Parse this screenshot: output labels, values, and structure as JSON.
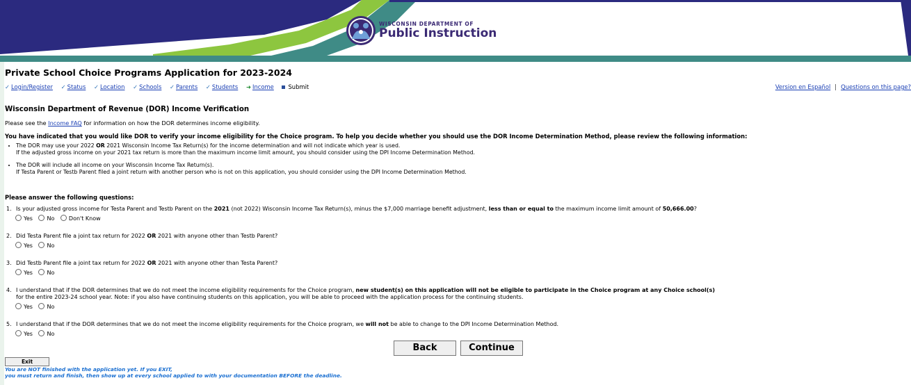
{
  "header": {
    "org_line1": "WISCONSIN DEPARTMENT OF",
    "org_line2": "Public Instruction"
  },
  "app": {
    "title": "Private School Choice Programs Application for 2023-2024"
  },
  "steps": [
    {
      "label": "Login/Register",
      "state": "done"
    },
    {
      "label": "Status",
      "state": "done"
    },
    {
      "label": "Location",
      "state": "done"
    },
    {
      "label": "Schools",
      "state": "done"
    },
    {
      "label": "Parents",
      "state": "done"
    },
    {
      "label": "Students",
      "state": "done"
    },
    {
      "label": "Income",
      "state": "current"
    },
    {
      "label": "Submit",
      "state": "pending"
    }
  ],
  "toplinks": {
    "spanish": "Version en Español",
    "separator": "|",
    "questions": "Questions on this page?"
  },
  "section": {
    "title": "Wisconsin Department of Revenue (DOR) Income Verification",
    "see_prefix": "Please see the ",
    "faq_link": "Income FAQ",
    "see_suffix": " for information on how the DOR determines income eligibility.",
    "intro": "You have indicated that you would like DOR to verify your income eligibility for the Choice program. To help you decide whether you should use the DOR Income Determination Method, please review the following information:"
  },
  "info": [
    {
      "l1_a": "The DOR may use your 2022 ",
      "l1_b": "OR",
      "l1_c": " 2021 Wisconsin Income Tax Return(s) for the income determination and will not indicate which year is used.",
      "l2": "If the adjusted gross income on your 2021 tax return is more than the maximum income limit amount, you should consider using the DPI Income Determination Method."
    },
    {
      "l1": "The DOR will include all income on your Wisconsin Income Tax Return(s).",
      "l2": "If Testa Parent or Testb Parent filed a joint return with another person who is not on this application, you should consider using the DPI Income Determination Method."
    }
  ],
  "questions_heading": "Please answer the following questions:",
  "questions": {
    "q1": {
      "num": "1.",
      "t1": "Is your adjusted gross income for Testa Parent and Testb Parent on the ",
      "t2": "2021",
      "t3": " (not 2022) Wisconsin Income Tax Return(s), minus the $7,000 marriage benefit adjustment, ",
      "t4": "less than or equal to",
      "t5": " the maximum income limit amount of ",
      "t6": "50,666.00",
      "t7": "?",
      "options": [
        "Yes",
        "No",
        "Don't Know"
      ]
    },
    "q2": {
      "num": "2.",
      "t1": "Did Testa Parent file a joint tax return for 2022 ",
      "t2": "OR",
      "t3": " 2021 with anyone other than Testb Parent?",
      "options": [
        "Yes",
        "No"
      ]
    },
    "q3": {
      "num": "3.",
      "t1": "Did Testb Parent file a joint tax return for 2022 ",
      "t2": "OR",
      "t3": " 2021 with anyone other than Testa Parent?",
      "options": [
        "Yes",
        "No"
      ]
    },
    "q4": {
      "num": "4.",
      "t1": "I understand that if the DOR determines that we do not meet the income eligibility requirements for the Choice program, ",
      "t2": "new student(s) on this application will not be eligible to participate in the Choice program at any Choice school(s)",
      "t3": "for the entire 2023-24 school year. Note: if you also have continuing students on this application, you will be able to proceed with the application process for the continuing students.",
      "options": [
        "Yes",
        "No"
      ]
    },
    "q5": {
      "num": "5.",
      "t1": "I understand that if the DOR determines that we do not meet the income eligibility requirements for the Choice program, we ",
      "t2": "will not",
      "t3": " be able to change to the DPI Income Determination Method.",
      "options": [
        "Yes",
        "No"
      ]
    }
  },
  "buttons": {
    "back": "Back",
    "continue": "Continue",
    "exit": "Exit"
  },
  "exit_warning": {
    "line1": "You are NOT finished with the application yet. If you EXIT,",
    "line2": "you must return and finish, then show up at every school applied to with your documentation BEFORE the deadline."
  },
  "colors": {
    "banner_navy": "#2b2a7f",
    "banner_green": "#8dc63f",
    "banner_teal": "#3f8b86",
    "link_blue": "#1a3fb4",
    "warning_blue": "#1a6fd1"
  },
  "icons": {
    "done": "checkmark-icon",
    "current": "arrow-right-icon",
    "pending": "square-bullet-icon",
    "logo": "dpi-people-logo-icon"
  }
}
